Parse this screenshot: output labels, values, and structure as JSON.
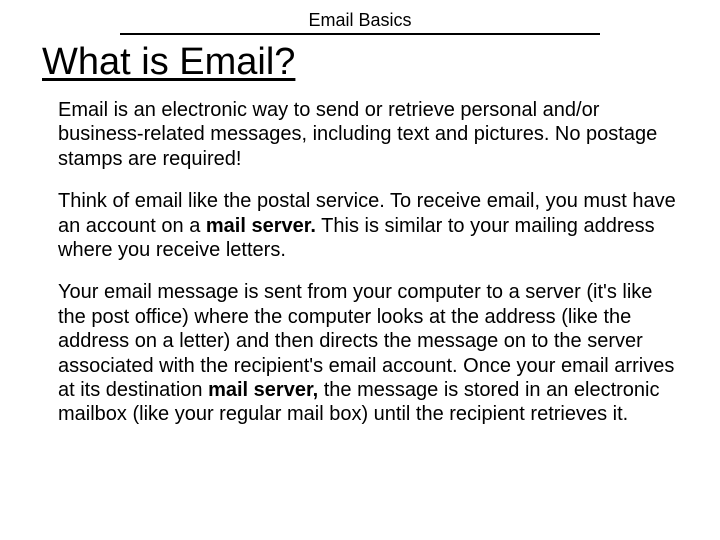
{
  "header": {
    "label": "Email Basics"
  },
  "title": "What is Email?",
  "paragraphs": {
    "p1": "Email is an electronic way to send or retrieve personal and/or business‐related messages, including text and pictures. No postage stamps are required!",
    "p2_pre": "Think of email like the postal service. To receive email, you must have an account on a ",
    "p2_bold": "mail server.",
    "p2_post": " This is similar to your mailing address where you receive letters.",
    "p3_pre": "Your email message is sent from your computer to a server (it's like the post office) where the computer looks at the address (like the address on a letter) and then directs the message on to the server associated with the recipient's email account. Once your email arrives at its destination ",
    "p3_bold": "mail server,",
    "p3_post": " the message is stored in an electronic mailbox (like your regular mail box) until the recipient retrieves it."
  }
}
